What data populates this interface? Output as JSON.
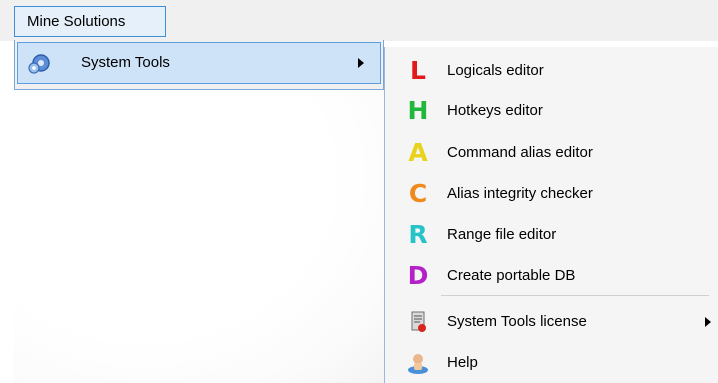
{
  "menubar": {
    "title": "Mine Solutions"
  },
  "menu": {
    "system_tools": {
      "label": "System Tools",
      "icon": "gears-icon"
    }
  },
  "submenu": {
    "items": [
      {
        "label": "Logicals editor",
        "letter": "L",
        "color": "#e01a1a"
      },
      {
        "label": "Hotkeys editor",
        "letter": "H",
        "color": "#1fb83a"
      },
      {
        "label": "Command alias editor",
        "letter": "A",
        "color": "#e8d21a"
      },
      {
        "label": "Alias integrity checker",
        "letter": "C",
        "color": "#ef8a1c"
      },
      {
        "label": "Range file editor",
        "letter": "R",
        "color": "#26c3c8"
      },
      {
        "label": "Create portable DB",
        "letter": "D",
        "color": "#b421c9"
      }
    ],
    "license": {
      "label": "System Tools license",
      "icon": "license-icon"
    },
    "help": {
      "label": "Help",
      "icon": "help-icon"
    }
  }
}
